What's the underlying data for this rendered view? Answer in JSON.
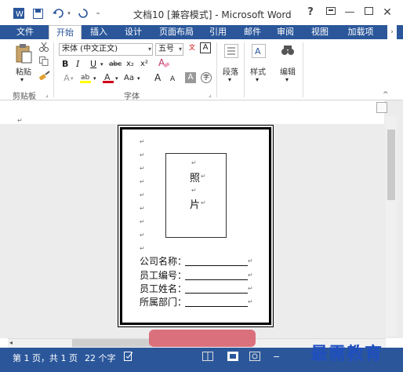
{
  "window": {
    "title": "文档10 [兼容模式] - Microsoft Word",
    "help": "?",
    "controls": [
      "restore",
      "minimize",
      "maximize",
      "close"
    ]
  },
  "tabs": [
    {
      "label": "文件",
      "active": false
    },
    {
      "label": "开始",
      "active": true
    },
    {
      "label": "插入",
      "active": false
    },
    {
      "label": "设计",
      "active": false
    },
    {
      "label": "页面布局",
      "active": false
    },
    {
      "label": "引用",
      "active": false
    },
    {
      "label": "邮件",
      "active": false
    },
    {
      "label": "审阅",
      "active": false
    },
    {
      "label": "视图",
      "active": false
    },
    {
      "label": "加载项",
      "active": false
    }
  ],
  "ribbon": {
    "clipboard": {
      "paste_label": "粘贴",
      "group_label": "剪贴板"
    },
    "font": {
      "font_name": "宋体 (中文正文)",
      "font_size": "五号",
      "bold": "B",
      "italic": "I",
      "underline": "U",
      "strike": "abc",
      "subscript": "x₂",
      "superscript": "x²",
      "change_case": "Aa",
      "grow": "A",
      "shrink": "A",
      "group_label": "字体"
    },
    "paragraph_label": "段落",
    "styles_label": "样式",
    "editing_label": "编辑"
  },
  "document": {
    "photo_line1": "照",
    "photo_line2": "片",
    "fields": [
      {
        "label": "公司名称："
      },
      {
        "label": "员工编号："
      },
      {
        "label": "员工姓名："
      },
      {
        "label": "所属部门："
      }
    ]
  },
  "status": {
    "page": "第 1 页，共 1 页",
    "words": "22 个字"
  },
  "watermark": "最需教育",
  "colors": {
    "accent": "#2b579a",
    "font_color_red": "#d0021b",
    "highlight_yellow": "#ffff00"
  }
}
